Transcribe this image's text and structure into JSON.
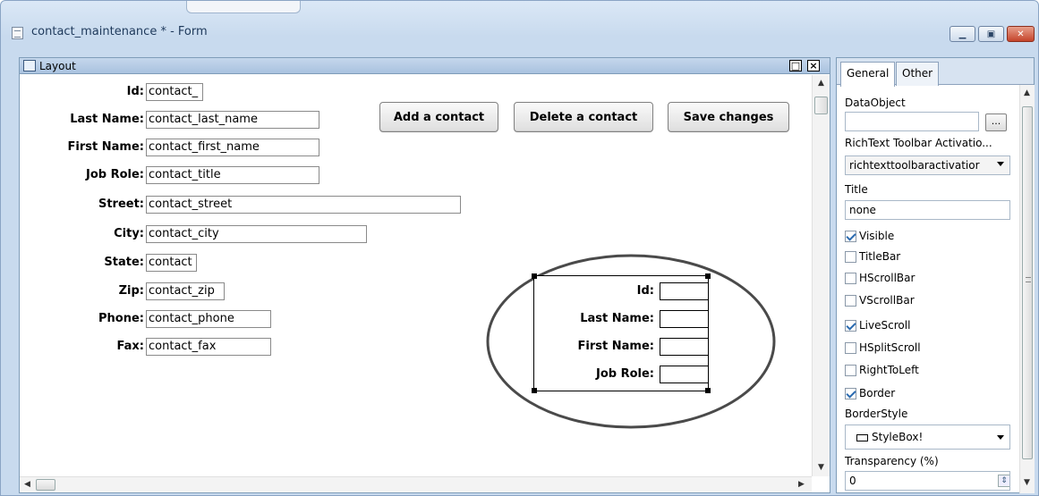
{
  "window": {
    "title": "contact_maintenance * - Form"
  },
  "layout": {
    "title": "Layout",
    "header_buttons": {
      "maximize": "□",
      "close": "×"
    },
    "fields": [
      {
        "label": "Id:",
        "value": "contact_"
      },
      {
        "label": "Last Name:",
        "value": "contact_last_name"
      },
      {
        "label": "First Name:",
        "value": "contact_first_name"
      },
      {
        "label": "Job Role:",
        "value": "contact_title"
      },
      {
        "label": "Street:",
        "value": "contact_street"
      },
      {
        "label": "City:",
        "value": "contact_city"
      },
      {
        "label": "State:",
        "value": "contact"
      },
      {
        "label": "Zip:",
        "value": "contact_zip"
      },
      {
        "label": "Phone:",
        "value": "contact_phone"
      },
      {
        "label": "Fax:",
        "value": "contact_fax"
      }
    ],
    "buttons": {
      "add": "Add a contact",
      "delete": "Delete a contact",
      "save": "Save changes"
    },
    "callout": {
      "labels": [
        "Id:",
        "Last Name:",
        "First Name:",
        "Job Role:"
      ]
    }
  },
  "properties": {
    "tabs": [
      "General",
      "Other"
    ],
    "active_tab": "General",
    "dataobject_label": "DataObject",
    "dataobject_value": "",
    "ellipsis": "...",
    "richtext_label": "RichText Toolbar Activatio...",
    "richtext_value": "richtexttoolbaractivatior",
    "title_label": "Title",
    "title_value": "none",
    "checkboxes": [
      {
        "label": "Visible",
        "checked": true
      },
      {
        "label": "TitleBar",
        "checked": false
      },
      {
        "label": "HScrollBar",
        "checked": false
      },
      {
        "label": "VScrollBar",
        "checked": false
      },
      {
        "label": "LiveScroll",
        "checked": true
      },
      {
        "label": "HSplitScroll",
        "checked": false
      },
      {
        "label": "RightToLeft",
        "checked": false
      },
      {
        "label": "Border",
        "checked": true
      }
    ],
    "borderstyle_label": "BorderStyle",
    "borderstyle_value": "StyleBox!",
    "transparency_label": "Transparency (%)",
    "transparency_value": "0"
  },
  "icons": [
    "form-icon",
    "minimize-icon",
    "maximize-icon",
    "close-icon",
    "layout-icon",
    "scroll-up-icon",
    "scroll-down-icon",
    "scroll-left-icon",
    "scroll-right-icon",
    "dropdown-arrow-icon",
    "stylebox-icon",
    "spinner-icon"
  ]
}
